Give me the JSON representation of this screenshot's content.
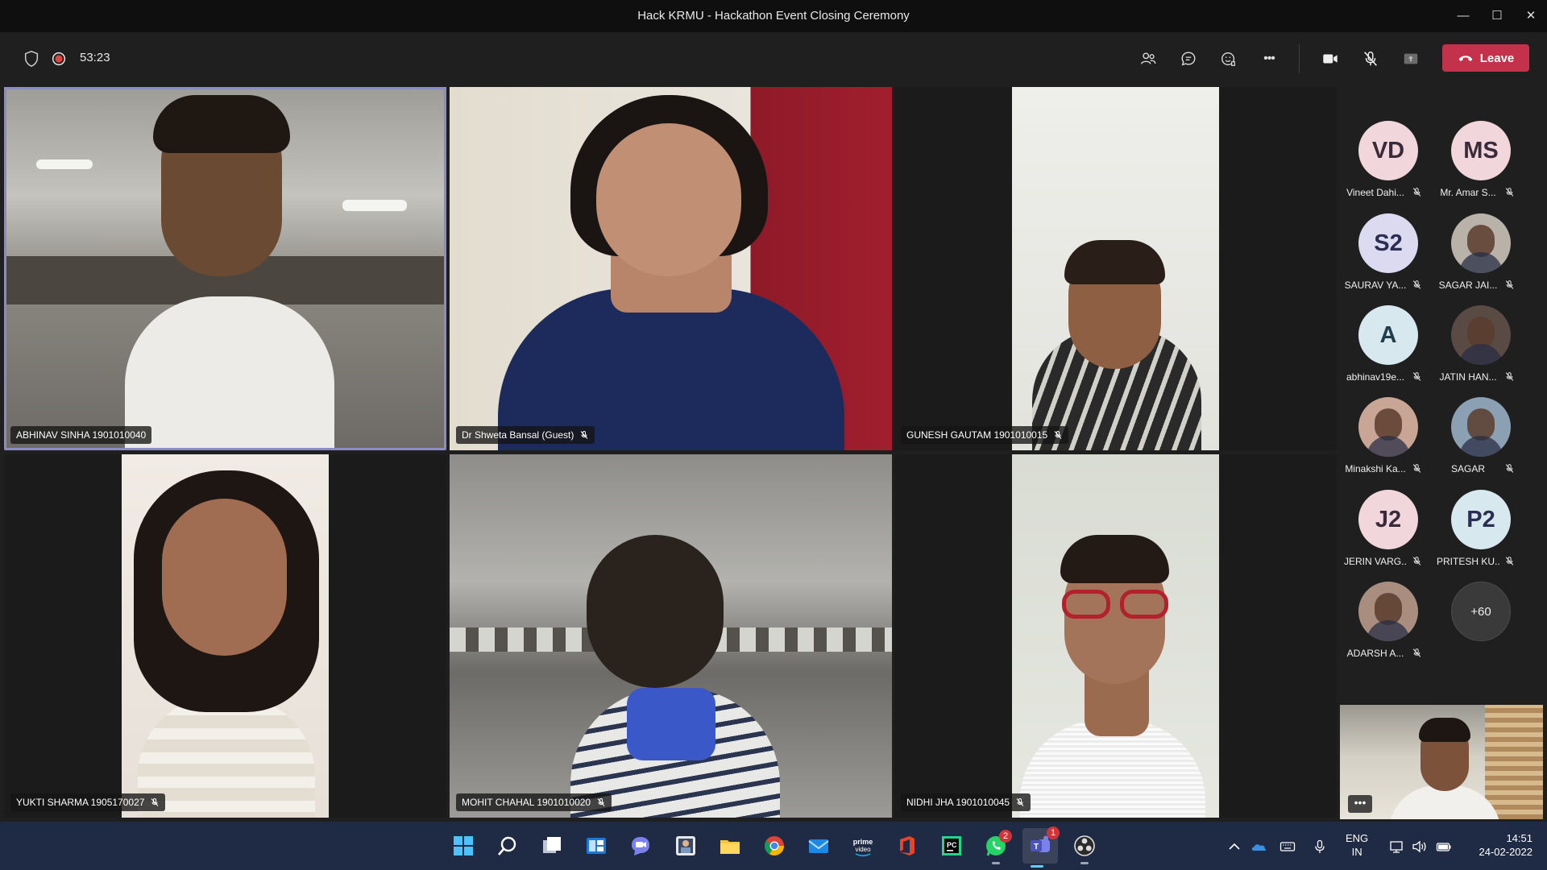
{
  "window": {
    "title": "Hack KRMU - Hackathon Event Closing Ceremony",
    "minimize_glyph": "—",
    "maximize_glyph": "☐",
    "close_glyph": "✕"
  },
  "toolbar": {
    "timer": "53:23",
    "leave_label": "Leave",
    "more_glyph": "•••"
  },
  "colors": {
    "accent_active_border": "#8b8cc7",
    "leave_red": "#c4314b",
    "recording_red": "#e0443e"
  },
  "tiles": [
    {
      "name": "ABHINAV SINHA 1901010040",
      "icon": "mic-off-icon",
      "active_speaker": true
    },
    {
      "name": "Dr Shweta Bansal (Guest)",
      "icon": "mic-off-icon"
    },
    {
      "name": "GUNESH GAUTAM 1901010015",
      "icon": "mic-off-icon"
    },
    {
      "name": "YUKTI SHARMA 1905170027",
      "icon": "mic-off-icon"
    },
    {
      "name": "MOHIT CHAHAL 1901010020",
      "icon": "mic-off-icon"
    },
    {
      "name": "NIDHI JHA 1901010045",
      "icon": "mic-off-icon"
    }
  ],
  "roster": [
    {
      "initials": "VD",
      "name": "Vineet Dahi...",
      "color": "#f1d6dc"
    },
    {
      "initials": "MS",
      "name": "Mr. Amar S...",
      "color": "#f1d6dc"
    },
    {
      "initials": "S2",
      "name": "SAURAV YA...",
      "color": "#dcdaf0"
    },
    {
      "initials": "",
      "name": "SAGAR JAI...",
      "color": "#b9b2a8"
    },
    {
      "initials": "A",
      "name": "abhinav19e...",
      "color": "#d7e8ee"
    },
    {
      "initials": "",
      "name": "JATIN HAN...",
      "color": "#5a4a44"
    },
    {
      "initials": "",
      "name": "Minakshi Ka...",
      "color": "#c9a596"
    },
    {
      "initials": "",
      "name": "SAGAR",
      "color": "#8ba0b3"
    },
    {
      "initials": "J2",
      "name": "JERIN VARG...",
      "color": "#f1d6dc"
    },
    {
      "initials": "P2",
      "name": "PRITESH KU...",
      "color": "#d7e8ee"
    },
    {
      "initials": "",
      "name": "ADARSH A...",
      "color": "#a98e80"
    }
  ],
  "roster_more": "+60",
  "self_view": {
    "more_glyph": "•••"
  },
  "taskbar": {
    "apps": [
      {
        "name": "start-icon"
      },
      {
        "name": "search-icon"
      },
      {
        "name": "task-view-icon"
      },
      {
        "name": "widgets-icon"
      },
      {
        "name": "chat-icon"
      },
      {
        "name": "photo-app-icon"
      },
      {
        "name": "file-explorer-icon"
      },
      {
        "name": "chrome-icon"
      },
      {
        "name": "mail-icon"
      },
      {
        "name": "prime-video-icon",
        "label": "prime video"
      },
      {
        "name": "office-icon"
      },
      {
        "name": "pycharm-icon",
        "label": "PC"
      },
      {
        "name": "whatsapp-icon",
        "badge": "2"
      },
      {
        "name": "teams-icon",
        "badge": "1"
      },
      {
        "name": "obs-icon"
      }
    ],
    "language_line1": "ENG",
    "language_line2": "IN",
    "time": "14:51",
    "date": "24-02-2022"
  }
}
